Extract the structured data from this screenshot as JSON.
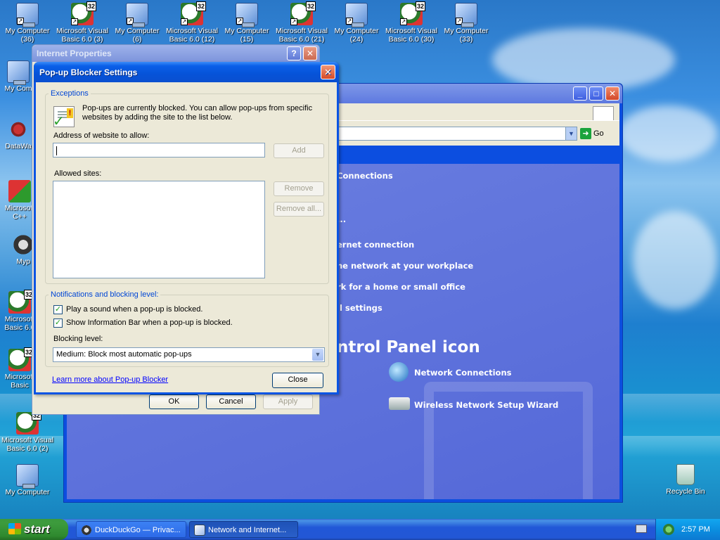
{
  "desktop": {
    "top_icons": [
      {
        "label": "My Computer (36)",
        "kind": "computer"
      },
      {
        "label": "Microsoft Visual Basic 6.0 (3)",
        "kind": "vb"
      },
      {
        "label": "My Computer (6)",
        "kind": "computer"
      },
      {
        "label": "Microsoft Visual Basic 6.0 (12)",
        "kind": "vb"
      },
      {
        "label": "My Computer (15)",
        "kind": "computer"
      },
      {
        "label": "Microsoft Visual Basic 6.0 (21)",
        "kind": "vb"
      },
      {
        "label": "My Computer (24)",
        "kind": "computer"
      },
      {
        "label": "Microsoft Visual Basic 6.0 (30)",
        "kind": "vb"
      },
      {
        "label": "My Computer (33)",
        "kind": "computer"
      }
    ],
    "left_icons": [
      {
        "label": "My Com"
      },
      {
        "label": "DataWa"
      },
      {
        "label": "Microsoft C++"
      },
      {
        "label": "Myp"
      },
      {
        "label": "Microsoft Basic 6.0"
      },
      {
        "label": "Microsoft Basic"
      },
      {
        "label": "Microsoft Visual Basic 6.0 (2)"
      },
      {
        "label": "My Computer"
      }
    ],
    "recycle_bin_label": "Recycle Bin",
    "vb_badge": "32"
  },
  "control_panel": {
    "address_go": "Go",
    "heading_connections": "Connections",
    "tasks": [
      "...",
      "ernet connection",
      "he network at your workplace",
      "rk for a home or small office",
      "ll settings"
    ],
    "pick_heading": "ntrol Panel icon",
    "icons": [
      "Network Connections",
      "Wireless Network Setup Wizard"
    ]
  },
  "internet_properties": {
    "title": "Internet Properties",
    "help_glyph": "?",
    "close_glyph": "✕",
    "ok_label": "OK",
    "cancel_label": "Cancel",
    "apply_label": "Apply"
  },
  "popup_blocker": {
    "title": "Pop-up Blocker Settings",
    "close_glyph": "✕",
    "exceptions_title": "Exceptions",
    "info_text_line1": "Pop-ups are currently blocked.  You can allow pop-ups from specific",
    "info_text_line2": "websites by adding the site to the list below.",
    "address_label": "Address of website to allow:",
    "address_value": "",
    "add_label": "Add",
    "allowed_label": "Allowed sites:",
    "remove_label": "Remove",
    "remove_all_label": "Remove all...",
    "notifications_title": "Notifications and blocking level:",
    "play_sound_label": "Play a sound when a pop-up is blocked.",
    "play_sound_checked": true,
    "info_bar_label": "Show Information Bar when a pop-up is blocked.",
    "info_bar_checked": true,
    "blocking_level_label": "Blocking level:",
    "blocking_level_value": "Medium: Block most automatic pop-ups",
    "learn_more_link": "Learn more about Pop-up Blocker",
    "close_button_label": "Close",
    "check_glyph": "✓"
  },
  "taskbar": {
    "start_label": "start",
    "tasks": [
      {
        "label": "DuckDuckGo — Privac...",
        "active": false
      },
      {
        "label": "Network and Internet...",
        "active": true
      }
    ],
    "clock": "2:57 PM"
  }
}
